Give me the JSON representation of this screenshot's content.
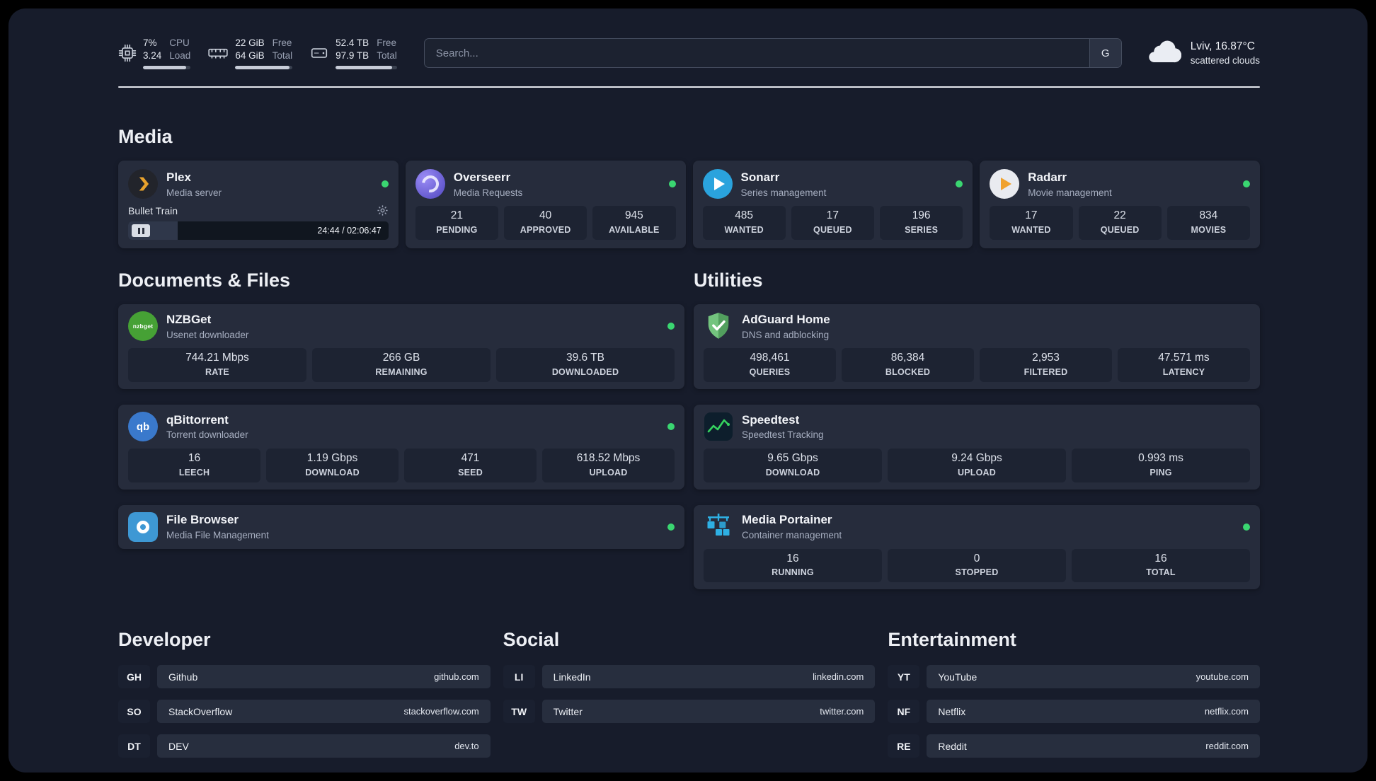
{
  "colors": {
    "background": "#000000",
    "panel": "#171c2b",
    "card": "#262c3c",
    "stat_tile": "#1d2332",
    "status_online": "#3ad671",
    "plex_accent": "#e8a22c"
  },
  "topbar": {
    "cpu": {
      "icon": "cpu-icon",
      "value_top": "7%",
      "value_bottom": "3.24",
      "label_top": "CPU",
      "label_bottom": "Load",
      "bar_percent": 90
    },
    "ram": {
      "icon": "ram-icon",
      "value_top": "22 GiB",
      "value_bottom": "64 GiB",
      "label_top": "Free",
      "label_bottom": "Total",
      "bar_percent": 95
    },
    "disk": {
      "icon": "disk-icon",
      "value_top": "52.4 TB",
      "value_bottom": "97.9 TB",
      "label_top": "Free",
      "label_bottom": "Total",
      "bar_percent": 92
    },
    "search": {
      "placeholder": "Search...",
      "engine_label": "G"
    },
    "weather": {
      "icon": "cloud-icon",
      "location": "Lviv, 16.87°C",
      "condition": "scattered clouds"
    }
  },
  "sections": {
    "media": {
      "title": "Media",
      "apps": [
        {
          "name": "Plex",
          "subtitle": "Media server",
          "icon": "plex-icon",
          "online": true,
          "player": {
            "track": "Bullet Train",
            "time": "24:44 / 02:06:47",
            "progress_percent": 19
          }
        },
        {
          "name": "Overseerr",
          "subtitle": "Media Requests",
          "icon": "overseerr-icon",
          "online": true,
          "stats": [
            {
              "value": "21",
              "label": "PENDING"
            },
            {
              "value": "40",
              "label": "APPROVED"
            },
            {
              "value": "945",
              "label": "AVAILABLE"
            }
          ]
        },
        {
          "name": "Sonarr",
          "subtitle": "Series management",
          "icon": "sonarr-icon",
          "online": true,
          "stats": [
            {
              "value": "485",
              "label": "WANTED"
            },
            {
              "value": "17",
              "label": "QUEUED"
            },
            {
              "value": "196",
              "label": "SERIES"
            }
          ]
        },
        {
          "name": "Radarr",
          "subtitle": "Movie management",
          "icon": "radarr-icon",
          "online": true,
          "stats": [
            {
              "value": "17",
              "label": "WANTED"
            },
            {
              "value": "22",
              "label": "QUEUED"
            },
            {
              "value": "834",
              "label": "MOVIES"
            }
          ]
        }
      ]
    },
    "documents": {
      "title": "Documents & Files",
      "apps": [
        {
          "name": "NZBGet",
          "subtitle": "Usenet downloader",
          "icon": "nzbget-icon",
          "icon_text": "nzbget",
          "online": true,
          "stats": [
            {
              "value": "744.21 Mbps",
              "label": "RATE"
            },
            {
              "value": "266 GB",
              "label": "REMAINING"
            },
            {
              "value": "39.6 TB",
              "label": "DOWNLOADED"
            }
          ]
        },
        {
          "name": "qBittorrent",
          "subtitle": "Torrent downloader",
          "icon": "qbittorrent-icon",
          "icon_text": "qb",
          "online": true,
          "stats": [
            {
              "value": "16",
              "label": "LEECH"
            },
            {
              "value": "1.19 Gbps",
              "label": "DOWNLOAD"
            },
            {
              "value": "471",
              "label": "SEED"
            },
            {
              "value": "618.52 Mbps",
              "label": "UPLOAD"
            }
          ]
        },
        {
          "name": "File Browser",
          "subtitle": "Media File Management",
          "icon": "filebrowser-icon",
          "online": true
        }
      ]
    },
    "utilities": {
      "title": "Utilities",
      "apps": [
        {
          "name": "AdGuard Home",
          "subtitle": "DNS and adblocking",
          "icon": "adguard-icon",
          "online": false,
          "stats": [
            {
              "value": "498,461",
              "label": "QUERIES"
            },
            {
              "value": "86,384",
              "label": "BLOCKED"
            },
            {
              "value": "2,953",
              "label": "FILTERED"
            },
            {
              "value": "47.571 ms",
              "label": "LATENCY"
            }
          ]
        },
        {
          "name": "Speedtest",
          "subtitle": "Speedtest Tracking",
          "icon": "speedtest-icon",
          "online": false,
          "stats": [
            {
              "value": "9.65 Gbps",
              "label": "DOWNLOAD"
            },
            {
              "value": "9.24 Gbps",
              "label": "UPLOAD"
            },
            {
              "value": "0.993 ms",
              "label": "PING"
            }
          ]
        },
        {
          "name": "Media Portainer",
          "subtitle": "Container management",
          "icon": "portainer-icon",
          "online": true,
          "stats": [
            {
              "value": "16",
              "label": "RUNNING"
            },
            {
              "value": "0",
              "label": "STOPPED"
            },
            {
              "value": "16",
              "label": "TOTAL"
            }
          ]
        }
      ]
    },
    "developer": {
      "title": "Developer",
      "bookmarks": [
        {
          "abbr": "GH",
          "name": "Github",
          "url": "github.com"
        },
        {
          "abbr": "SO",
          "name": "StackOverflow",
          "url": "stackoverflow.com"
        },
        {
          "abbr": "DT",
          "name": "DEV",
          "url": "dev.to"
        }
      ]
    },
    "social": {
      "title": "Social",
      "bookmarks": [
        {
          "abbr": "LI",
          "name": "LinkedIn",
          "url": "linkedin.com"
        },
        {
          "abbr": "TW",
          "name": "Twitter",
          "url": "twitter.com"
        }
      ]
    },
    "entertainment": {
      "title": "Entertainment",
      "bookmarks": [
        {
          "abbr": "YT",
          "name": "YouTube",
          "url": "youtube.com"
        },
        {
          "abbr": "NF",
          "name": "Netflix",
          "url": "netflix.com"
        },
        {
          "abbr": "RE",
          "name": "Reddit",
          "url": "reddit.com"
        }
      ]
    }
  }
}
